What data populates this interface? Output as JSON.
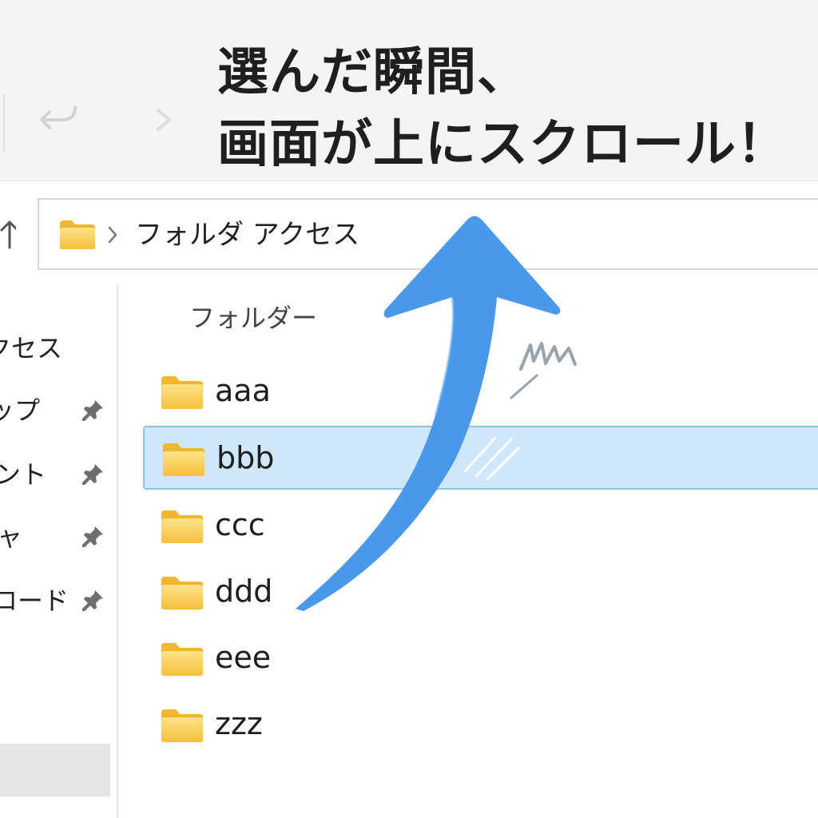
{
  "headline": {
    "line1": "選んだ瞬間、",
    "line2": "画面が上にスクロール！"
  },
  "address_bar": {
    "path": "フォルダ アクセス"
  },
  "sidebar": {
    "items": [
      {
        "label": "クセス",
        "pinned": false
      },
      {
        "label": "ップ",
        "pinned": true
      },
      {
        "label": "メント",
        "pinned": true
      },
      {
        "label": "ャ",
        "pinned": true
      },
      {
        "label": "ンロード",
        "pinned": true
      }
    ]
  },
  "content": {
    "section_title": "フォルダー",
    "folders": [
      {
        "name": "aaa",
        "selected": false
      },
      {
        "name": "bbb",
        "selected": true
      },
      {
        "name": "ccc",
        "selected": false
      },
      {
        "name": "ddd",
        "selected": false
      },
      {
        "name": "eee",
        "selected": false
      },
      {
        "name": "zzz",
        "selected": false
      }
    ]
  },
  "colors": {
    "selection": "#cfe6fb",
    "selection_border": "#8cc4ec",
    "arrow": "#4a98ea",
    "folder": "#f7c948"
  },
  "icons": {
    "back": "back-arrow-icon",
    "forward": "forward-arrow-icon",
    "up": "up-arrow-icon",
    "folder": "folder-icon",
    "pin": "pin-icon",
    "scroll_arrow": "scroll-up-arrow"
  }
}
